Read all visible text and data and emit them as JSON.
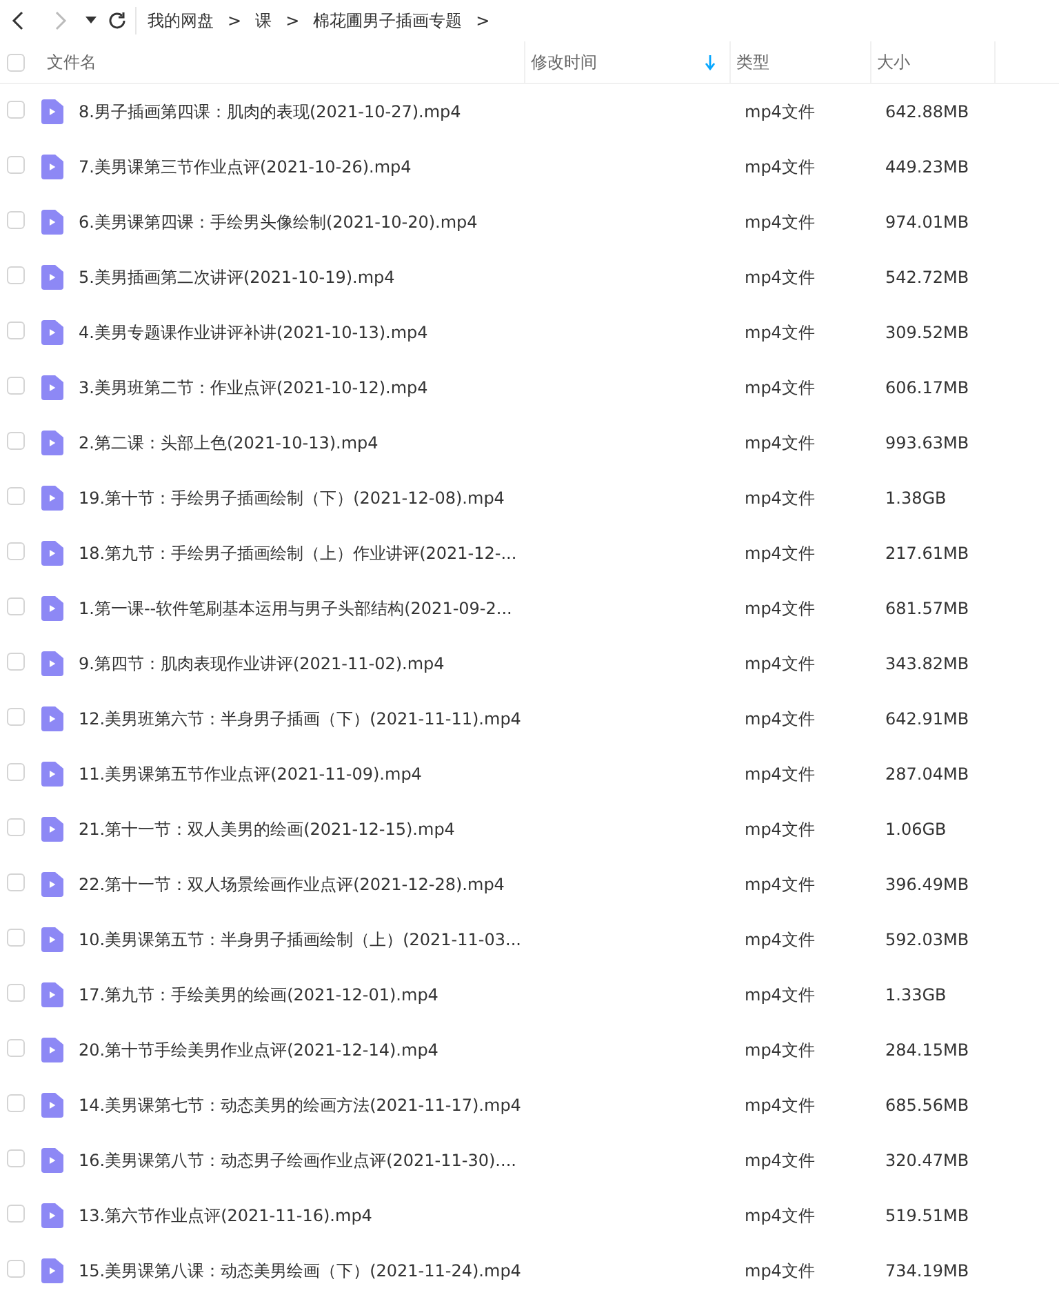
{
  "breadcrumb": [
    {
      "label": "我的网盘",
      "separator": ">"
    },
    {
      "label": "课",
      "separator": ">"
    },
    {
      "label": "棉花圃男子插画专题",
      "separator": ">"
    }
  ],
  "table": {
    "select_all": {
      "checked": false
    },
    "columns": [
      {
        "label": "文件名",
        "sorted": false
      },
      {
        "label": "修改时间",
        "sorted": true
      },
      {
        "label": "类型",
        "sorted": false
      },
      {
        "label": "大小",
        "sorted": false
      }
    ],
    "rows": [
      {
        "checked": false,
        "name": "8.男子插画第四课：肌肉的表现(2021-10-27).mp4",
        "type": "mp4文件",
        "size": "642.88MB"
      },
      {
        "checked": false,
        "name": "7.美男课第三节作业点评(2021-10-26).mp4",
        "type": "mp4文件",
        "size": "449.23MB"
      },
      {
        "checked": false,
        "name": "6.美男课第四课：手绘男头像绘制(2021-10-20).mp4",
        "type": "mp4文件",
        "size": "974.01MB"
      },
      {
        "checked": false,
        "name": "5.美男插画第二次讲评(2021-10-19).mp4",
        "type": "mp4文件",
        "size": "542.72MB"
      },
      {
        "checked": false,
        "name": "4.美男专题课作业讲评补讲(2021-10-13).mp4",
        "type": "mp4文件",
        "size": "309.52MB"
      },
      {
        "checked": false,
        "name": "3.美男班第二节：作业点评(2021-10-12).mp4",
        "type": "mp4文件",
        "size": "606.17MB"
      },
      {
        "checked": false,
        "name": "2.第二课：头部上色(2021-10-13).mp4",
        "type": "mp4文件",
        "size": "993.63MB"
      },
      {
        "checked": false,
        "name": "19.第十节：手绘男子插画绘制（下）(2021-12-08).mp4",
        "type": "mp4文件",
        "size": "1.38GB"
      },
      {
        "checked": false,
        "name": "18.第九节：手绘男子插画绘制（上）作业讲评(2021-12-...",
        "type": "mp4文件",
        "size": "217.61MB"
      },
      {
        "checked": false,
        "name": "1.第一课--软件笔刷基本运用与男子头部结构(2021-09-2...",
        "type": "mp4文件",
        "size": "681.57MB"
      },
      {
        "checked": false,
        "name": "9.第四节：肌肉表现作业讲评(2021-11-02).mp4",
        "type": "mp4文件",
        "size": "343.82MB"
      },
      {
        "checked": false,
        "name": "12.美男班第六节：半身男子插画（下）(2021-11-11).mp4",
        "type": "mp4文件",
        "size": "642.91MB"
      },
      {
        "checked": false,
        "name": "11.美男课第五节作业点评(2021-11-09).mp4",
        "type": "mp4文件",
        "size": "287.04MB"
      },
      {
        "checked": false,
        "name": "21.第十一节：双人美男的绘画(2021-12-15).mp4",
        "type": "mp4文件",
        "size": "1.06GB"
      },
      {
        "checked": false,
        "name": "22.第十一节：双人场景绘画作业点评(2021-12-28).mp4",
        "type": "mp4文件",
        "size": "396.49MB"
      },
      {
        "checked": false,
        "name": "10.美男课第五节：半身男子插画绘制（上）(2021-11-03...",
        "type": "mp4文件",
        "size": "592.03MB"
      },
      {
        "checked": false,
        "name": "17.第九节：手绘美男的绘画(2021-12-01).mp4",
        "type": "mp4文件",
        "size": "1.33GB"
      },
      {
        "checked": false,
        "name": "20.第十节手绘美男作业点评(2021-12-14).mp4",
        "type": "mp4文件",
        "size": "284.15MB"
      },
      {
        "checked": false,
        "name": "14.美男课第七节：动态美男的绘画方法(2021-11-17).mp4",
        "type": "mp4文件",
        "size": "685.56MB"
      },
      {
        "checked": false,
        "name": "16.美男课第八节：动态男子绘画作业点评(2021-11-30)....",
        "type": "mp4文件",
        "size": "320.47MB"
      },
      {
        "checked": false,
        "name": "13.第六节作业点评(2021-11-16).mp4",
        "type": "mp4文件",
        "size": "519.51MB"
      },
      {
        "checked": false,
        "name": "15.美男课第八课：动态美男绘画（下）(2021-11-24).mp4",
        "type": "mp4文件",
        "size": "734.19MB"
      }
    ]
  }
}
